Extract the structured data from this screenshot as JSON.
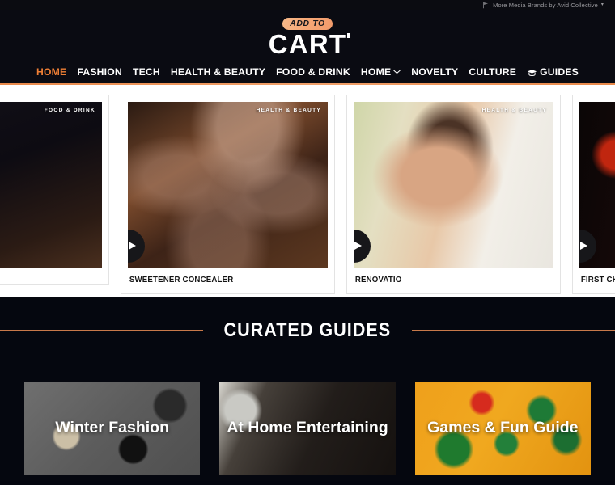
{
  "topbar": {
    "link_label": "More Media Brands by Avid Collective",
    "caret": "▾",
    "icon": "flag-icon"
  },
  "brand": {
    "pill_text": "ADD TO",
    "word_mark": "CART"
  },
  "nav": {
    "items": [
      {
        "label": "HOME",
        "active": true,
        "has_chevron": false,
        "icon": null
      },
      {
        "label": "FASHION",
        "active": false,
        "has_chevron": false,
        "icon": null
      },
      {
        "label": "TECH",
        "active": false,
        "has_chevron": false,
        "icon": null
      },
      {
        "label": "HEALTH & BEAUTY",
        "active": false,
        "has_chevron": false,
        "icon": null
      },
      {
        "label": "FOOD & DRINK",
        "active": false,
        "has_chevron": false,
        "icon": null
      },
      {
        "label": "HOME",
        "active": false,
        "has_chevron": true,
        "icon": null
      },
      {
        "label": "NOVELTY",
        "active": false,
        "has_chevron": false,
        "icon": null
      },
      {
        "label": "CULTURE",
        "active": false,
        "has_chevron": false,
        "icon": null
      },
      {
        "label": "GUIDES",
        "active": false,
        "has_chevron": false,
        "icon": "graduation-cap-icon"
      }
    ],
    "chevron_glyph": "⌄"
  },
  "carousel": {
    "slides": [
      {
        "title": "",
        "tag": "FOOD & DRINK",
        "art": "img-cocktail"
      },
      {
        "title": "SWEETENER CONCEALER",
        "tag": "HEALTH & BEAUTY",
        "art": "img-jars"
      },
      {
        "title": "RENOVATIO",
        "tag": "HEALTH & BEAUTY",
        "art": "img-skincare"
      },
      {
        "title": "FIRST CHOICE LIQUOR MARKET",
        "tag": "",
        "art": "img-cans"
      }
    ],
    "play_label": "Play video"
  },
  "guides": {
    "section_title": "CURATED GUIDES",
    "cards": [
      {
        "label": "Winter Fashion",
        "art": "bg-winter"
      },
      {
        "label": "At Home Entertaining",
        "art": "bg-home"
      },
      {
        "label": "Games & Fun Guide",
        "art": "bg-games"
      }
    ]
  },
  "colors": {
    "accent_orange": "#ef7f35",
    "rule_orange": "#c8794a",
    "page_dark": "#05070f",
    "header_dark": "#0a0b12",
    "white": "#ffffff"
  }
}
